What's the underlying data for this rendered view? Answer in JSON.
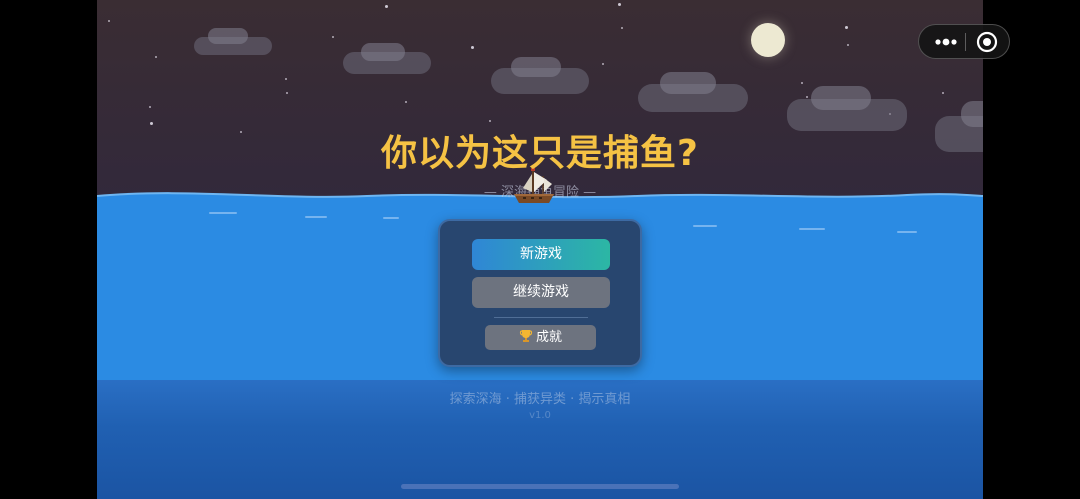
{
  "game": {
    "title": "你以为这只是捕鱼?",
    "subtitle": "— 深海捕鱼冒险 —",
    "tagline": "探索深海 · 捕获异类 · 揭示真相",
    "version": "v1.0"
  },
  "menu": {
    "new_game_label": "新游戏",
    "continue_label": "继续游戏",
    "achievements_label": "成就",
    "achievements_icon": "trophy-icon"
  },
  "capsule": {
    "more_icon": "more-dots-icon",
    "close_icon": "target-close-icon"
  },
  "colors": {
    "title": "#f5c244",
    "sea": "#2a8ae0",
    "deep_sea": "#1f5cad",
    "panel": "#28466f",
    "new_game_gradient_start": "#2f86d6",
    "new_game_gradient_end": "#2cb7a4",
    "secondary_button": "#6d737f"
  }
}
